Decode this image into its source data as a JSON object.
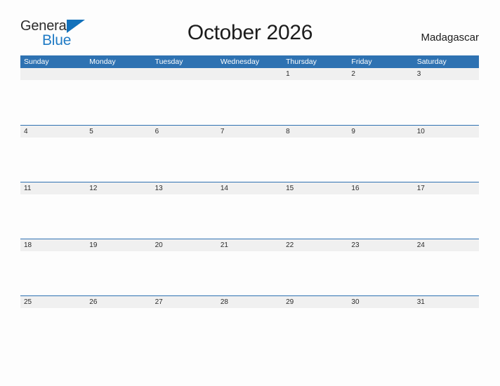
{
  "brand": {
    "name_part1": "General",
    "name_part2": "Blue",
    "flag_icon": "blue-triangle-flag-icon",
    "colors": {
      "general_text": "#2b2b2b",
      "blue_text": "#1f7ac4",
      "flag": "#1271bb"
    }
  },
  "header": {
    "title": "October 2026",
    "country": "Madagascar"
  },
  "calendar": {
    "colors": {
      "header_bar": "#2e72b2",
      "day_band": "#f0f0f0",
      "row_divider": "#2e72b2",
      "day_text": "#2b2b2b",
      "weekday_text": "#ffffff"
    },
    "weekdays": [
      "Sunday",
      "Monday",
      "Tuesday",
      "Wednesday",
      "Thursday",
      "Friday",
      "Saturday"
    ],
    "weeks": [
      [
        "",
        "",
        "",
        "",
        "1",
        "2",
        "3"
      ],
      [
        "4",
        "5",
        "6",
        "7",
        "8",
        "9",
        "10"
      ],
      [
        "11",
        "12",
        "13",
        "14",
        "15",
        "16",
        "17"
      ],
      [
        "18",
        "19",
        "20",
        "21",
        "22",
        "23",
        "24"
      ],
      [
        "25",
        "26",
        "27",
        "28",
        "29",
        "30",
        "31"
      ]
    ]
  }
}
